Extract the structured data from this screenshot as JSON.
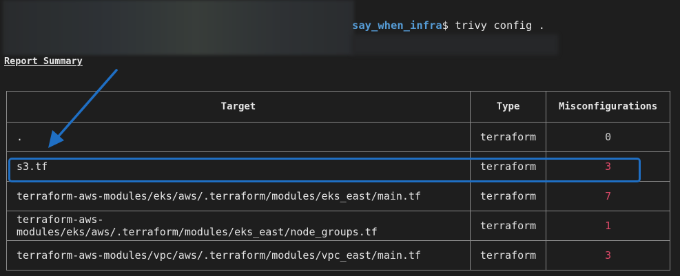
{
  "terminal": {
    "prompt_path": "say_when_infra",
    "prompt_suffix": "$",
    "command": " trivy config ."
  },
  "report": {
    "title": "Report Summary",
    "columns": [
      "Target",
      "Type",
      "Misconfigurations"
    ],
    "rows": [
      {
        "target": ".",
        "type": "terraform",
        "misconfigurations": "0"
      },
      {
        "target": "s3.tf",
        "type": "terraform",
        "misconfigurations": "3"
      },
      {
        "target": "terraform-aws-modules/eks/aws/.terraform/modules/eks_east/main.tf",
        "type": "terraform",
        "misconfigurations": "7"
      },
      {
        "target": "terraform-aws-modules/eks/aws/.terraform/modules/eks_east/node_groups.tf",
        "type": "terraform",
        "misconfigurations": "1"
      },
      {
        "target": "terraform-aws-modules/vpc/aws/.terraform/modules/vpc_east/main.tf",
        "type": "terraform",
        "misconfigurations": "3"
      }
    ]
  },
  "annotation": {
    "highlight_color": "#1f6fc4",
    "arrow_color": "#1f6fc4",
    "highlighted_row": "s3.tf"
  },
  "colors": {
    "background": "#1e1e1e",
    "path": "#569cd6",
    "nonzero_count": "#e04a6a",
    "zero_count": "#cccccc"
  }
}
